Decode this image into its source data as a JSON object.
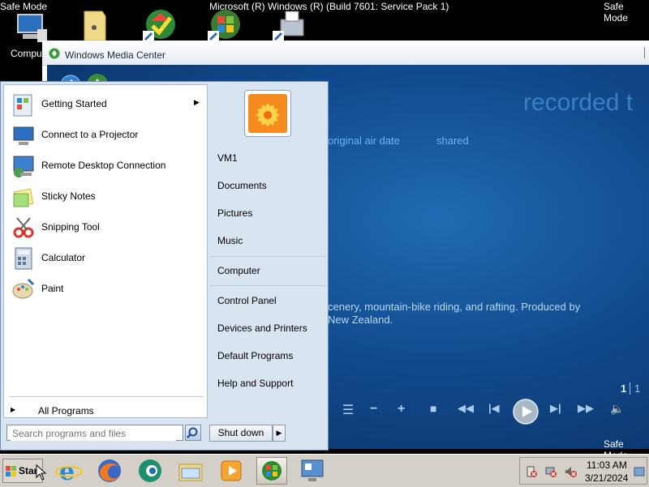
{
  "top_bar": {
    "safe_mode_left": "Safe Mode",
    "build": "Microsoft (R) Windows (R) (Build 7601: Service Pack 1)",
    "safe_mode_right": "Safe Mode"
  },
  "bottom_safe_mode": "Safe Mode",
  "desktop": {
    "computer_label": "Compu"
  },
  "wmc": {
    "title": "Windows Media Center",
    "heading": "recorded t",
    "filters": [
      "original air date",
      "shared"
    ],
    "description_line1": "cenery, mountain-bike riding, and rafting. Produced by",
    "description_line2": "New Zealand.",
    "page_current": "1",
    "page_total": "1"
  },
  "start_menu": {
    "programs": [
      {
        "label": "Getting Started",
        "icon": "getting-started-icon",
        "has_submenu": true
      },
      {
        "label": "Connect to a Projector",
        "icon": "projector-icon",
        "has_submenu": false
      },
      {
        "label": "Remote Desktop Connection",
        "icon": "remote-desktop-icon",
        "has_submenu": false
      },
      {
        "label": "Sticky Notes",
        "icon": "sticky-notes-icon",
        "has_submenu": false
      },
      {
        "label": "Snipping Tool",
        "icon": "snipping-tool-icon",
        "has_submenu": false
      },
      {
        "label": "Calculator",
        "icon": "calculator-icon",
        "has_submenu": false
      },
      {
        "label": "Paint",
        "icon": "paint-icon",
        "has_submenu": false
      }
    ],
    "all_programs": "All Programs",
    "search_placeholder": "Search programs and files",
    "right_links": [
      "VM1",
      "Documents",
      "Pictures",
      "Music",
      "Computer",
      "Control Panel",
      "Devices and Printers",
      "Default Programs",
      "Help and Support"
    ],
    "shutdown": "Shut down"
  },
  "taskbar": {
    "start": "Start",
    "time": "11:03 AM",
    "date": "3/21/2024"
  },
  "colors": {
    "accent": "#1f6bb3",
    "menu_border": "#6f8fb8",
    "taskbar": "#d4d0c8"
  }
}
